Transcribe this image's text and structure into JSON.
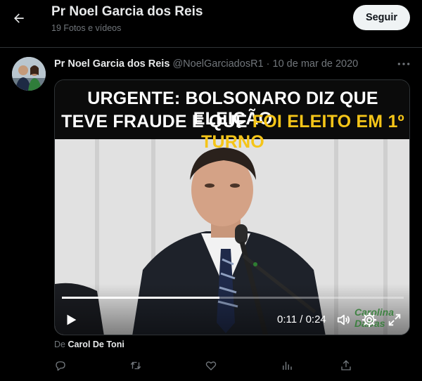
{
  "header": {
    "title": "Pr Noel Garcia dos Reis",
    "subtitle": "19 Fotos e vídeos",
    "follow_label": "Seguir"
  },
  "tweet": {
    "author_name": "Pr Noel Garcia dos Reis",
    "author_handle": "@NoelGarciadosR1",
    "separator": "·",
    "date": "10 de mar de 2020",
    "media": {
      "banner_line1": "URGENTE: BOLSONARO DIZ QUE ELEIÇÃO",
      "banner_line2_plain": "TEVE FRAUDE E QUE ",
      "banner_line2_highlight": "FOI ELEITO EM 1º TURNO",
      "watermark": "Carolina DaDas",
      "time_readout": "0:11 / 0:24",
      "progress_fraction": 0.46
    },
    "credit_prefix": "De",
    "credit_name": "Carol De Toni"
  },
  "icons": {
    "back": "arrow-left-icon",
    "more": "more-horizontal-icon",
    "play": "play-icon",
    "volume": "volume-icon",
    "settings": "gear-icon",
    "fullscreen": "fullscreen-icon",
    "reply": "reply-icon",
    "retweet": "retweet-icon",
    "like": "heart-icon",
    "views": "analytics-icon",
    "share": "share-icon"
  },
  "colors": {
    "background": "#000000",
    "text_primary": "#e7e9ea",
    "text_secondary": "#71767b",
    "follow_bg": "#eff3f4",
    "banner_highlight": "#f5c518"
  }
}
